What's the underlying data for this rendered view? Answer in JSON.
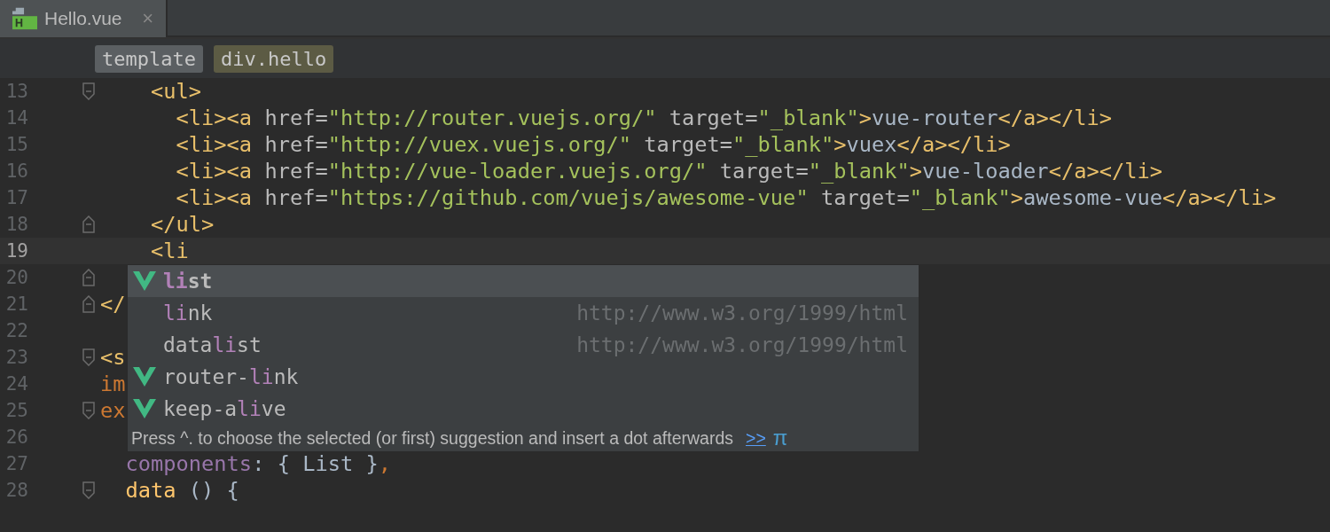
{
  "tabs": [
    {
      "label": "Hello.vue",
      "selected": true,
      "close": "×"
    }
  ],
  "breadcrumbs": [
    {
      "label": "template",
      "kind": "tag"
    },
    {
      "label": "div.hello",
      "kind": "current"
    }
  ],
  "lines": [
    {
      "number": "13",
      "block_start": true,
      "current": false,
      "tokens": [
        {
          "kind": "tag",
          "text": "    <ul>"
        }
      ]
    },
    {
      "number": "14",
      "current": false,
      "tokens": [
        {
          "kind": "tag",
          "text": "      <li><a "
        },
        {
          "kind": "attr",
          "text": "href="
        },
        {
          "kind": "string",
          "text": "\"http://router.vuejs.org/\" "
        },
        {
          "kind": "attr",
          "text": "target="
        },
        {
          "kind": "string",
          "text": "\"_blank\""
        },
        {
          "kind": "tag",
          "text": ">"
        },
        {
          "kind": "text",
          "text": "vue-router"
        },
        {
          "kind": "tag",
          "text": "</a></li>"
        }
      ]
    },
    {
      "number": "15",
      "current": false,
      "tokens": [
        {
          "kind": "tag",
          "text": "      <li><a "
        },
        {
          "kind": "attr",
          "text": "href="
        },
        {
          "kind": "string",
          "text": "\"http://vuex.vuejs.org/\" "
        },
        {
          "kind": "attr",
          "text": "target="
        },
        {
          "kind": "string",
          "text": "\"_blank\""
        },
        {
          "kind": "tag",
          "text": ">"
        },
        {
          "kind": "text",
          "text": "vuex"
        },
        {
          "kind": "tag",
          "text": "</a></li>"
        }
      ]
    },
    {
      "number": "16",
      "current": false,
      "tokens": [
        {
          "kind": "tag",
          "text": "      <li><a "
        },
        {
          "kind": "attr",
          "text": "href="
        },
        {
          "kind": "string",
          "text": "\"http://vue-loader.vuejs.org/\" "
        },
        {
          "kind": "attr",
          "text": "target="
        },
        {
          "kind": "string",
          "text": "\"_blank\""
        },
        {
          "kind": "tag",
          "text": ">"
        },
        {
          "kind": "text",
          "text": "vue-loader"
        },
        {
          "kind": "tag",
          "text": "</a></li>"
        }
      ]
    },
    {
      "number": "17",
      "current": false,
      "tokens": [
        {
          "kind": "tag",
          "text": "      <li><a "
        },
        {
          "kind": "attr",
          "text": "href="
        },
        {
          "kind": "string",
          "text": "\"https://github.com/vuejs/awesome-vue\" "
        },
        {
          "kind": "attr",
          "text": "target="
        },
        {
          "kind": "string",
          "text": "\"_blank\""
        },
        {
          "kind": "tag",
          "text": ">"
        },
        {
          "kind": "text",
          "text": "awesome-vue"
        },
        {
          "kind": "tag",
          "text": "</a></li>"
        }
      ]
    },
    {
      "number": "18",
      "block_start": false,
      "current": false,
      "tokens": [
        {
          "kind": "tag",
          "text": "    </ul>"
        }
      ]
    },
    {
      "number": "19",
      "current": true,
      "tokens": [
        {
          "kind": "tag",
          "text": "    <li"
        }
      ]
    },
    {
      "number": "20",
      "block_start": false,
      "current": false
    },
    {
      "number": "21",
      "block_start": false,
      "current": false,
      "tokens": [
        {
          "kind": "tag",
          "text": "</"
        }
      ]
    },
    {
      "number": "22",
      "current": false
    },
    {
      "number": "23",
      "block_start": true,
      "current": false,
      "tokens": [
        {
          "kind": "tag",
          "text": "<s"
        }
      ]
    },
    {
      "number": "24",
      "current": false,
      "tokens": [
        {
          "kind": "keyword",
          "text": "im"
        }
      ]
    },
    {
      "number": "25",
      "block_start": true,
      "current": false,
      "tokens": [
        {
          "kind": "keyword",
          "text": "ex"
        }
      ]
    },
    {
      "number": "26",
      "current": false
    },
    {
      "number": "27",
      "current": false,
      "tokens": [
        {
          "kind": "prop",
          "text": "  components"
        },
        {
          "kind": "text",
          "text": ": { List }"
        },
        {
          "kind": "keyword",
          "text": ","
        }
      ]
    },
    {
      "number": "28",
      "block_start": true,
      "current": false,
      "tokens": [
        {
          "kind": "func",
          "text": "  data"
        },
        {
          "kind": "text",
          "text": " () {"
        }
      ]
    }
  ],
  "completion": {
    "items": [
      {
        "match": "li",
        "after": "st",
        "vue": true,
        "selected": true
      },
      {
        "match": "li",
        "after": "nk",
        "vue": false,
        "selected": false,
        "namespace": "http://www.w3.org/1999/html"
      },
      {
        "before": "data",
        "match": "li",
        "after": "st",
        "vue": false,
        "selected": false,
        "namespace": "http://www.w3.org/1999/html"
      },
      {
        "before": "router-",
        "match": "li",
        "after": "nk",
        "vue": true,
        "selected": false
      },
      {
        "before": "keep-a",
        "match": "li",
        "after": "ve",
        "vue": true,
        "selected": false
      }
    ],
    "hint": "Press ^. to choose the selected (or first) suggestion and insert a dot afterwards",
    "more_link": ">>",
    "pi": "π"
  }
}
